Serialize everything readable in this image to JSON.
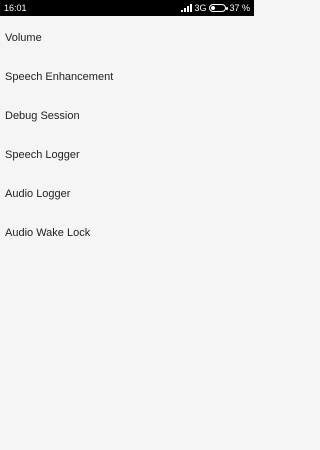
{
  "status_bar": {
    "time": "16:01",
    "network": "3G",
    "battery": "37 %"
  },
  "menu": {
    "items": [
      {
        "label": "Volume"
      },
      {
        "label": "Speech Enhancement"
      },
      {
        "label": "Debug Session"
      },
      {
        "label": "Speech Logger"
      },
      {
        "label": "Audio Logger"
      },
      {
        "label": "Audio Wake Lock"
      }
    ]
  }
}
